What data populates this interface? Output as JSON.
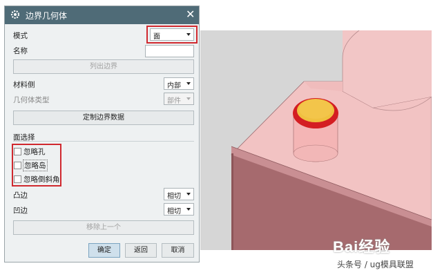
{
  "dialog": {
    "title": "边界几何体",
    "mode": {
      "label": "模式",
      "value": "面"
    },
    "name": {
      "label": "名称",
      "value": ""
    },
    "list_boundary_button": "列出边界",
    "material_side": {
      "label": "材料侧",
      "value": "内部"
    },
    "geometry_type": {
      "label": "几何体类型",
      "value": "部件"
    },
    "custom_boundary_button": "定制边界数据",
    "face_selection": {
      "label": "面选择",
      "options": [
        {
          "label": "忽略孔",
          "checked": false
        },
        {
          "label": "忽略岛",
          "checked": false
        },
        {
          "label": "忽略倒斜角",
          "checked": false
        }
      ]
    },
    "convex_edge": {
      "label": "凸边",
      "value": "相切"
    },
    "concave_edge": {
      "label": "凹边",
      "value": "相切"
    },
    "remove_last_button": "移除上一个",
    "ok_button": "确定",
    "back_button": "返回",
    "cancel_button": "取消"
  },
  "watermark": {
    "logo": "Bai经验",
    "subtitle": "头条号 / ug模具联盟"
  },
  "colors": {
    "titlebar": "#4f6b77",
    "highlight": "#d0282e",
    "part_top": "#f2c3c3",
    "part_front": "#a86a6e",
    "cylinder_top": "#f0c040",
    "cylinder_ring": "#d41e22"
  }
}
